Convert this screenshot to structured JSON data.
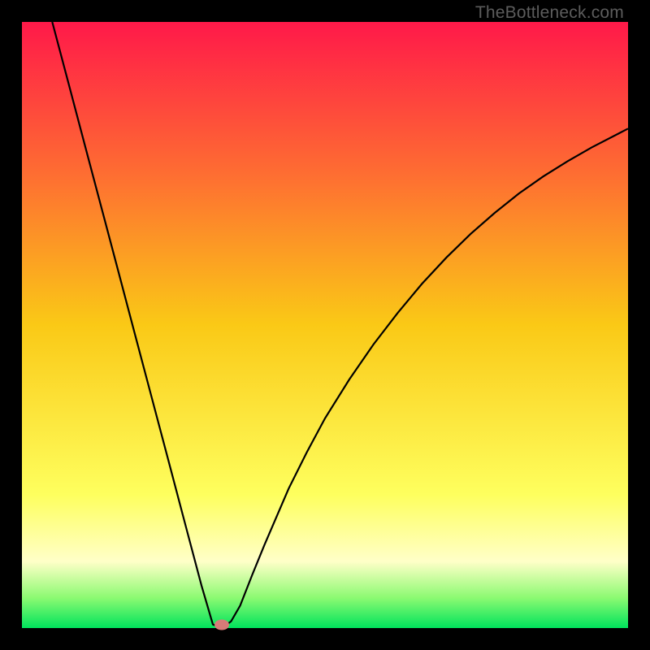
{
  "watermark": "TheBottleneck.com",
  "chart_data": {
    "type": "line",
    "title": "",
    "xlabel": "",
    "ylabel": "",
    "xlim": [
      0,
      100
    ],
    "ylim": [
      0,
      100
    ],
    "grid": false,
    "gradient_stops": [
      {
        "pct": 0,
        "color": "#ff1949"
      },
      {
        "pct": 25,
        "color": "#fe6d32"
      },
      {
        "pct": 50,
        "color": "#fac916"
      },
      {
        "pct": 78,
        "color": "#feff5e"
      },
      {
        "pct": 89,
        "color": "#ffffc8"
      },
      {
        "pct": 95,
        "color": "#8cfa72"
      },
      {
        "pct": 100,
        "color": "#00e35c"
      }
    ],
    "series": [
      {
        "name": "curve",
        "color": "#000000",
        "x": [
          5,
          7.74,
          10.47,
          13.21,
          15.95,
          18.68,
          21.42,
          24.16,
          26.89,
          29.63,
          31.5,
          33,
          34.5,
          36,
          38,
          40,
          44,
          47,
          50,
          54,
          58,
          62,
          66,
          70,
          74,
          78,
          82,
          86,
          90,
          94,
          100
        ],
        "y": [
          100,
          89.67,
          79.33,
          69,
          58.67,
          48.33,
          38,
          27.67,
          17.33,
          7,
          0.6,
          0,
          1.1,
          3.7,
          8.8,
          13.7,
          23,
          29,
          34.6,
          41,
          46.8,
          52,
          56.8,
          61.1,
          65,
          68.5,
          71.7,
          74.5,
          77,
          79.3,
          82.4
        ]
      }
    ],
    "marker": {
      "x": 33,
      "y": 0.6,
      "color": "#d77b78"
    }
  }
}
